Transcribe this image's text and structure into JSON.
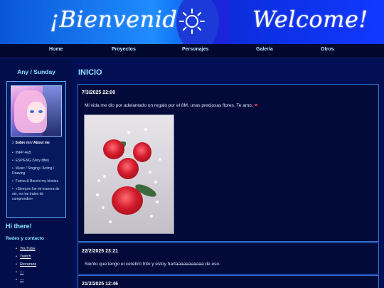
{
  "header": {
    "left_title": "¡Bienvenido!",
    "right_title": "Welcome!"
  },
  "nav": {
    "items": [
      "Home",
      "Proyectos",
      "Personajes",
      "Galería",
      "Otros"
    ]
  },
  "sidebar": {
    "title": "Any / Sunday",
    "about_heading": "Sobre mí / About me",
    "about_items": [
      "INFP 4w5",
      "ESP/ENG (Very little)",
      "Music / Singing / Acting / Drawing",
      "Furina & Bocchi my kinnies",
      "«Siempre fue mi manera de ser, no me trates de comprender»"
    ],
    "hi_there": "Hi there!",
    "redes_title": "Redes y contacto",
    "links": [
      "YouTube",
      "Twitch",
      "Recursos",
      "---",
      "---"
    ]
  },
  "main": {
    "page_title": "INICIO",
    "posts": [
      {
        "date": "7/3/2025 22:00",
        "text": "Mi vida me dio por adelantado un regalo por el 8M, unas preciosas flores. Te amo."
      },
      {
        "date": "22/2/2025 23:21",
        "text": "Siento que tengo el cerebro frito y estoy hartaaaaaaaaaaa de eso."
      },
      {
        "date": "21/2/2025 12:46",
        "text": ""
      }
    ]
  },
  "icons": {
    "banner": "sun-icon",
    "about": "moon-icon",
    "post": "heart-icon"
  },
  "colors": {
    "accent": "#8ee4ff",
    "background": "#020a3a",
    "border": "#2f78d8",
    "heart": "#e23b4a"
  }
}
